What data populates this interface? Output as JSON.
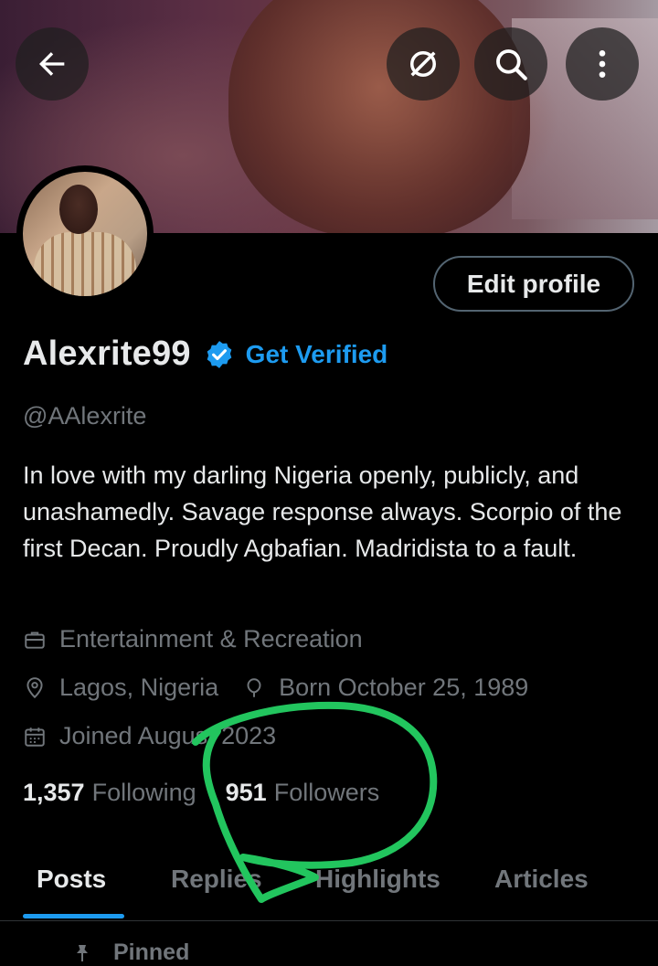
{
  "header": {
    "back_icon": "arrow-left-icon",
    "hide_icon": "slashed-circle-icon",
    "search_icon": "search-icon",
    "more_icon": "more-vertical-icon"
  },
  "profile": {
    "edit_label": "Edit profile",
    "display_name": "Alexrite99",
    "get_verified_label": "Get Verified",
    "handle": "@AAlexrite",
    "bio": "In love with my darling Nigeria openly, publicly, and unashamedly. Savage response always. Scorpio of the first Decan. Proudly Agbafian. Madridista to a fault.",
    "category": "Entertainment & Recreation",
    "location": "Lagos, Nigeria",
    "birthday": "Born October 25, 1989",
    "joined": "Joined August 2023",
    "following_count": "1,357",
    "following_label": "Following",
    "followers_count": "951",
    "followers_label": "Followers"
  },
  "tabs": [
    {
      "label": "Posts",
      "active": true
    },
    {
      "label": "Replies",
      "active": false
    },
    {
      "label": "Highlights",
      "active": false
    },
    {
      "label": "Articles",
      "active": false
    }
  ],
  "timeline": {
    "pinned_label": "Pinned"
  },
  "colors": {
    "accent": "#1d9bf0",
    "background": "#000000",
    "muted_text": "#71767b",
    "annotation_circle": "#22c55e"
  }
}
